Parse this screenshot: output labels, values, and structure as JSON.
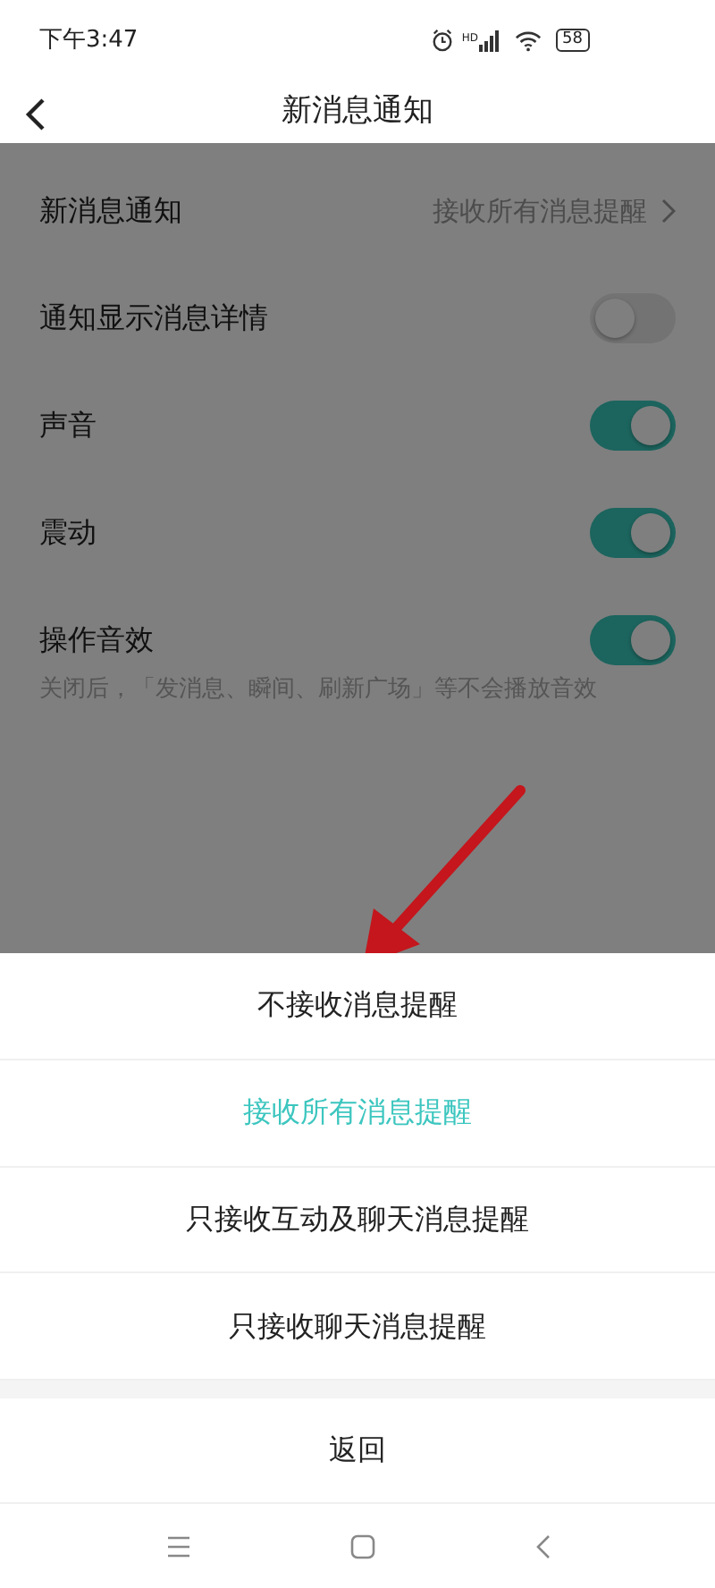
{
  "status_bar": {
    "time": "下午3:47",
    "network_label": "HD",
    "battery": "58"
  },
  "header": {
    "title": "新消息通知"
  },
  "settings": [
    {
      "kind": "link",
      "label": "新消息通知",
      "value": "接收所有消息提醒"
    },
    {
      "kind": "toggle",
      "label": "通知显示消息详情",
      "on": false
    },
    {
      "kind": "toggle",
      "label": "声音",
      "on": true
    },
    {
      "kind": "toggle",
      "label": "震动",
      "on": true
    },
    {
      "kind": "toggle",
      "label": "操作音效",
      "on": true,
      "note": "关闭后，「发消息、瞬间、刷新广场」等不会播放音效"
    }
  ],
  "sheet": {
    "options": [
      {
        "label": "不接收消息提醒",
        "selected": false
      },
      {
        "label": "接收所有消息提醒",
        "selected": true
      },
      {
        "label": "只接收互动及聊天消息提醒",
        "selected": false
      },
      {
        "label": "只接收聊天消息提醒",
        "selected": false
      }
    ],
    "cancel": "返回"
  }
}
